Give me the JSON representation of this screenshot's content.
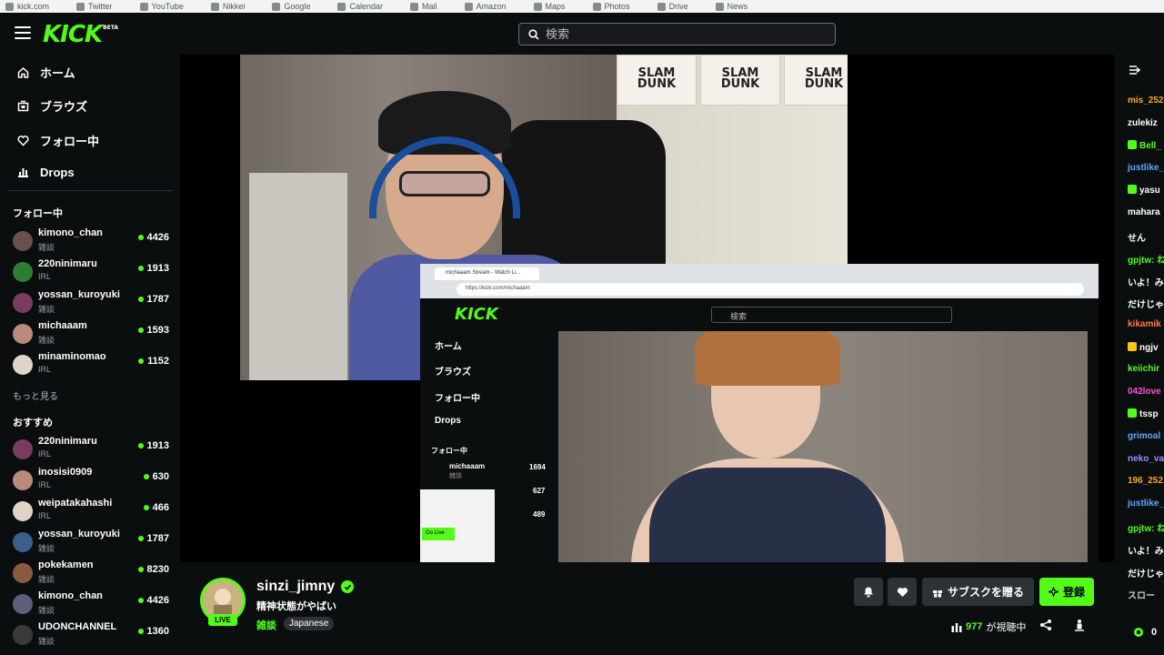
{
  "bookmarks": [
    "kick.com",
    "Twitter",
    "YouTube",
    "Nikkei",
    "Google",
    "Calendar",
    "Mail",
    "Amazon",
    "Maps",
    "Photos",
    "Drive",
    "News"
  ],
  "header": {
    "logo": "KICK",
    "beta": "BETA",
    "search_placeholder": "検索"
  },
  "sidebar": {
    "nav": [
      {
        "label": "ホーム",
        "icon": "home-icon"
      },
      {
        "label": "ブラウズ",
        "icon": "browse-icon"
      },
      {
        "label": "フォロー中",
        "icon": "heart-icon"
      },
      {
        "label": "Drops",
        "icon": "drops-icon"
      }
    ],
    "following_title": "フォロー中",
    "following": [
      {
        "name": "kimono_chan",
        "category": "雑談",
        "viewers": "4426"
      },
      {
        "name": "220ninimaru",
        "category": "IRL",
        "viewers": "1913"
      },
      {
        "name": "yossan_kuroyuki",
        "category": "雑談",
        "viewers": "1787"
      },
      {
        "name": "michaaam",
        "category": "雑談",
        "viewers": "1593"
      },
      {
        "name": "minaminomao",
        "category": "IRL",
        "viewers": "1152"
      }
    ],
    "show_more": "もっと見る",
    "recommended_title": "おすすめ",
    "recommended": [
      {
        "name": "220ninimaru",
        "category": "IRL",
        "viewers": "1913"
      },
      {
        "name": "inosisi0909",
        "category": "IRL",
        "viewers": "630"
      },
      {
        "name": "weipatakahashi",
        "category": "IRL",
        "viewers": "466"
      },
      {
        "name": "yossan_kuroyuki",
        "category": "雑談",
        "viewers": "1787"
      },
      {
        "name": "pokekamen",
        "category": "雑談",
        "viewers": "8230"
      },
      {
        "name": "kimono_chan",
        "category": "雑談",
        "viewers": "4426"
      },
      {
        "name": "UDONCHANNEL",
        "category": "雑談",
        "viewers": "1360"
      }
    ]
  },
  "video": {
    "posters": [
      "SLAM DUNK",
      "SLAM DUNK",
      "SLAM DUNK"
    ],
    "inner": {
      "tab": "michaaam Stream - Watch Li...",
      "url": "https://kick.com/michaaam",
      "logo": "KICK",
      "search": "検索",
      "nav": [
        "ホーム",
        "ブラウズ",
        "フォロー中",
        "Drops"
      ],
      "following_title": "フォロー中",
      "row_name": "michaaam",
      "row_cat": "雑談",
      "row_viewers": "1694",
      "row2_viewers": "627",
      "row3_viewers": "489",
      "golive": "Go Live"
    }
  },
  "chat": {
    "messages": [
      {
        "user": "mis_252",
        "color": "#f5a623"
      },
      {
        "user": "zulekiz",
        "color": "#ffffff"
      },
      {
        "user": "Bell_",
        "color": "#53fc18",
        "badge": "#53fc18"
      },
      {
        "user": "justlike_",
        "color": "#5aa9ff"
      },
      {
        "user": "yasu",
        "color": "#ffffff",
        "badge": "#53fc18"
      },
      {
        "user": "mahara",
        "color": "#ffffff"
      },
      {
        "user": "せん",
        "color": "#ffffff"
      },
      {
        "user": "gpjtw: ね",
        "color": "#53fc18"
      },
      {
        "user": "いよ！み",
        "color": "#ffffff"
      },
      {
        "user": "だけじゃ",
        "color": "#ffffff"
      },
      {
        "user": "kikamik",
        "color": "#ff7a3d"
      },
      {
        "user": "ngjv",
        "color": "#ffffff",
        "badge": "#f5c518"
      },
      {
        "user": "keiichir",
        "color": "#53fc18"
      },
      {
        "user": "042love",
        "color": "#ff4fd8"
      },
      {
        "user": "tssp",
        "color": "#ffffff",
        "badge": "#53fc18"
      },
      {
        "user": "grimoal",
        "color": "#5aa9ff"
      },
      {
        "user": "neko_va",
        "color": "#9f8cff"
      },
      {
        "user": "196_252",
        "color": "#f5a623"
      },
      {
        "user": "justlike_",
        "color": "#5aa9ff"
      },
      {
        "user": "gpjtw: ね",
        "color": "#53fc18"
      },
      {
        "user": "いよ！み",
        "color": "#ffffff"
      },
      {
        "user": "だけじゃ",
        "color": "#ffffff"
      },
      {
        "user": "スロー",
        "color": "#cccccc"
      }
    ],
    "points": "0"
  },
  "stream": {
    "streamer": "sinzi_jimny",
    "title": "精神状態がやばい",
    "category": "雑談",
    "language": "Japanese",
    "live_label": "LIVE",
    "gift_label": "サブスクを贈る",
    "follow_label": "登録",
    "viewer_count": "977",
    "viewer_suffix": "が視聴中"
  }
}
